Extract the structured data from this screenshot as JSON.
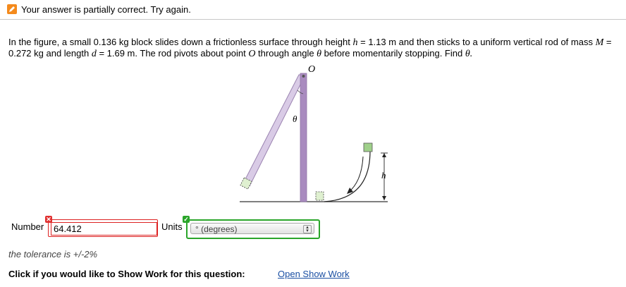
{
  "status": {
    "message": "Your answer is partially correct.  Try again.",
    "icon": "pencil-icon",
    "icon_color": "#f48a1c"
  },
  "question": {
    "part1": "In the figure, a small 0.136 kg block slides down a frictionless surface through height ",
    "h_var": "h",
    "part2": " = 1.13 m and then sticks to a uniform vertical rod of mass ",
    "M_var": "M",
    "part3": " = 0.272 kg and length ",
    "d_var": "d",
    "part4": " = 1.69 m. The rod pivots about point ",
    "O_var": "O",
    "part5": " through angle ",
    "theta_var": "θ",
    "part6": " before momentarily stopping. Find ",
    "theta_end": "θ."
  },
  "figure": {
    "label_O": "O",
    "label_theta": "θ",
    "label_h": "h"
  },
  "answer": {
    "number_label": "Number",
    "number_value": "64.412",
    "number_status": "incorrect",
    "units_label": "Units",
    "units_value": "° (degrees)",
    "units_status": "correct"
  },
  "tolerance": "the tolerance is +/-2%",
  "show_work": {
    "prompt": "Click if you would like to Show Work for this question:",
    "link": "Open Show Work"
  },
  "colors": {
    "incorrect": "#e03030",
    "correct": "#2aa52a",
    "link": "#1a4fa3",
    "rod": "#a98bbf"
  }
}
